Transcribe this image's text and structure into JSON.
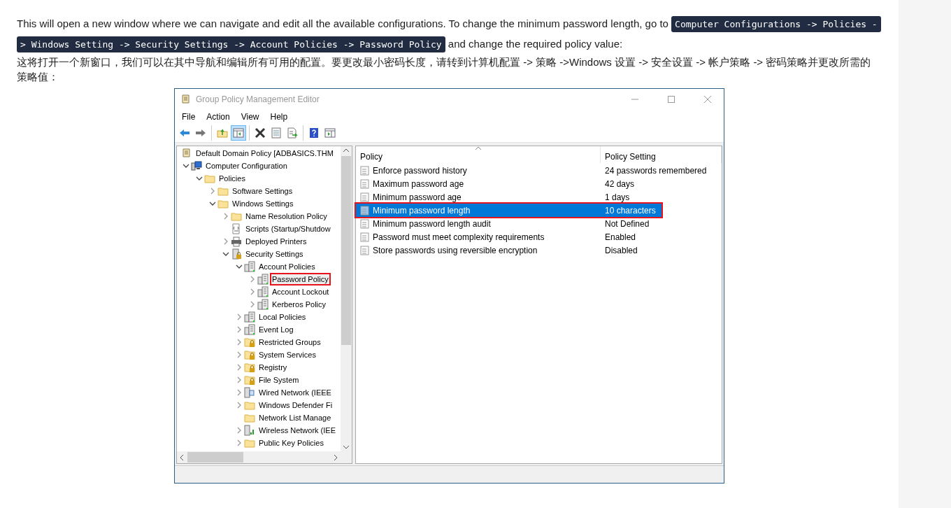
{
  "article": {
    "intro": {
      "before": "This will open a new window where we can navigate and edit all the available configurations. To change the minimum password length, go to",
      "code_lines": [
        "Computer Configurations -> Policies -",
        "> Windows Setting -> Security Settings -> Account Policies -> Password Policy"
      ],
      "after": "and change the required policy value:"
    },
    "intro_zh": "这将打开一个新窗口，我们可以在其中导航和编辑所有可用的配置。要更改最小密码长度，请转到计算机配置 -> 策略 ->Windows 设置 -> 安全设置 -> 帐户策略 -> 密码策略并更改所需的策略值："
  },
  "window": {
    "title": "Group Policy Management Editor",
    "menu": [
      "File",
      "Action",
      "View",
      "Help"
    ],
    "toolbar": [
      [
        {
          "kind": "back",
          "pressed": false
        },
        {
          "kind": "forward",
          "pressed": false
        }
      ],
      [
        {
          "kind": "up",
          "pressed": false
        },
        {
          "kind": "tree",
          "pressed": true
        }
      ],
      [
        {
          "kind": "delete",
          "pressed": false
        },
        {
          "kind": "properties",
          "pressed": false
        },
        {
          "kind": "export",
          "pressed": false
        }
      ],
      [
        {
          "kind": "help",
          "pressed": false
        },
        {
          "kind": "actions",
          "pressed": false
        }
      ]
    ],
    "tree": [
      {
        "label": "Default Domain Policy [ADBASICS.THM",
        "kind": "scroll",
        "highlighted": false,
        "children": [
          {
            "label": "Computer Configuration",
            "kind": "computer",
            "expandable": true,
            "expanded": true,
            "highlighted": false,
            "children": [
              {
                "label": "Policies",
                "kind": "folder",
                "expandable": true,
                "expanded": true,
                "highlighted": false,
                "children": [
                  {
                    "label": "Software Settings",
                    "kind": "folder",
                    "expandable": true,
                    "expanded": false,
                    "highlighted": false
                  },
                  {
                    "label": "Windows Settings",
                    "kind": "folder",
                    "expandable": true,
                    "expanded": true,
                    "highlighted": false,
                    "children": [
                      {
                        "label": "Name Resolution Policy",
                        "kind": "folder",
                        "expandable": true,
                        "expanded": false,
                        "highlighted": false
                      },
                      {
                        "label": "Scripts (Startup/Shutdow",
                        "kind": "script",
                        "expandable": false,
                        "highlighted": false
                      },
                      {
                        "label": "Deployed Printers",
                        "kind": "printer",
                        "expandable": true,
                        "expanded": false,
                        "highlighted": false
                      },
                      {
                        "label": "Security Settings",
                        "kind": "security",
                        "expandable": true,
                        "expanded": true,
                        "highlighted": false,
                        "children": [
                          {
                            "label": "Account Policies",
                            "kind": "policy",
                            "expandable": true,
                            "expanded": true,
                            "highlighted": false,
                            "children": [
                              {
                                "label": "Password Policy",
                                "kind": "policy",
                                "expandable": true,
                                "expanded": false,
                                "highlighted": true
                              },
                              {
                                "label": "Account Lockout",
                                "kind": "policy",
                                "expandable": true,
                                "expanded": false,
                                "highlighted": false
                              },
                              {
                                "label": "Kerberos Policy",
                                "kind": "policy",
                                "expandable": true,
                                "expanded": false,
                                "highlighted": false
                              }
                            ]
                          },
                          {
                            "label": "Local Policies",
                            "kind": "policy",
                            "expandable": true,
                            "expanded": false,
                            "highlighted": false
                          },
                          {
                            "label": "Event Log",
                            "kind": "policy",
                            "expandable": true,
                            "expanded": false,
                            "highlighted": false
                          },
                          {
                            "label": "Restricted Groups",
                            "kind": "locked",
                            "expandable": true,
                            "expanded": false,
                            "highlighted": false
                          },
                          {
                            "label": "System Services",
                            "kind": "locked",
                            "expandable": true,
                            "expanded": false,
                            "highlighted": false
                          },
                          {
                            "label": "Registry",
                            "kind": "locked",
                            "expandable": true,
                            "expanded": false,
                            "highlighted": false
                          },
                          {
                            "label": "File System",
                            "kind": "locked",
                            "expandable": true,
                            "expanded": false,
                            "highlighted": false
                          },
                          {
                            "label": "Wired Network (IEEE",
                            "kind": "wired",
                            "expandable": true,
                            "expanded": false,
                            "highlighted": false
                          },
                          {
                            "label": "Windows Defender Fi",
                            "kind": "folder",
                            "expandable": true,
                            "expanded": false,
                            "highlighted": false
                          },
                          {
                            "label": "Network List Manage",
                            "kind": "folder",
                            "expandable": false,
                            "highlighted": false
                          },
                          {
                            "label": "Wireless Network (IEE",
                            "kind": "wireless",
                            "expandable": true,
                            "expanded": false,
                            "highlighted": false
                          },
                          {
                            "label": "Public Key Policies",
                            "kind": "folder",
                            "expandable": true,
                            "expanded": false,
                            "highlighted": false
                          }
                        ]
                      }
                    ]
                  }
                ]
              }
            ]
          }
        ]
      }
    ],
    "list": {
      "columns": [
        {
          "label": "Policy",
          "sorted": true
        },
        {
          "label": "Policy Setting",
          "sorted": false
        }
      ],
      "rows": [
        {
          "policy": "Enforce password history",
          "setting": "24 passwords remembered",
          "selected": false,
          "highlighted": false
        },
        {
          "policy": "Maximum password age",
          "setting": "42 days",
          "selected": false,
          "highlighted": false
        },
        {
          "policy": "Minimum password age",
          "setting": "1 days",
          "selected": false,
          "highlighted": false
        },
        {
          "policy": "Minimum password length",
          "setting": "10 characters",
          "selected": true,
          "highlighted": true
        },
        {
          "policy": "Minimum password length audit",
          "setting": "Not Defined",
          "selected": false,
          "highlighted": false
        },
        {
          "policy": "Password must meet complexity requirements",
          "setting": "Enabled",
          "selected": false,
          "highlighted": false
        },
        {
          "policy": "Store passwords using reversible encryption",
          "setting": "Disabled",
          "selected": false,
          "highlighted": false
        }
      ]
    }
  }
}
